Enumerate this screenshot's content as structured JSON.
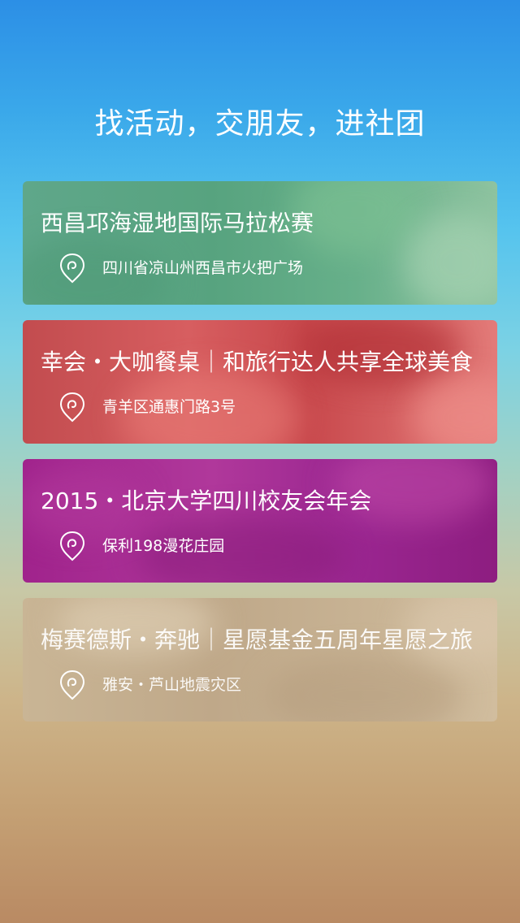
{
  "headline": "找活动，交朋友，进社团",
  "events": [
    {
      "title": "西昌邛海湿地国际马拉松赛",
      "location": "四川省凉山州西昌市火把广场",
      "location_icon": "location-pin-icon",
      "theme_color": "#5fa78a"
    },
    {
      "title": "幸会・大咖餐桌｜和旅行达人共享全球美食",
      "location": "青羊区通惠门路3号",
      "location_icon": "location-pin-icon",
      "theme_color": "#c24c4f"
    },
    {
      "title": "2015・北京大学四川校友会年会",
      "location": "保利198漫花庄园",
      "location_icon": "location-pin-icon",
      "theme_color": "#a0238c"
    },
    {
      "title": "梅赛德斯・奔驰｜星愿基金五周年星愿之旅",
      "location": "雅安・芦山地震灾区",
      "location_icon": "location-pin-icon",
      "theme_color": "#c9b595"
    }
  ]
}
